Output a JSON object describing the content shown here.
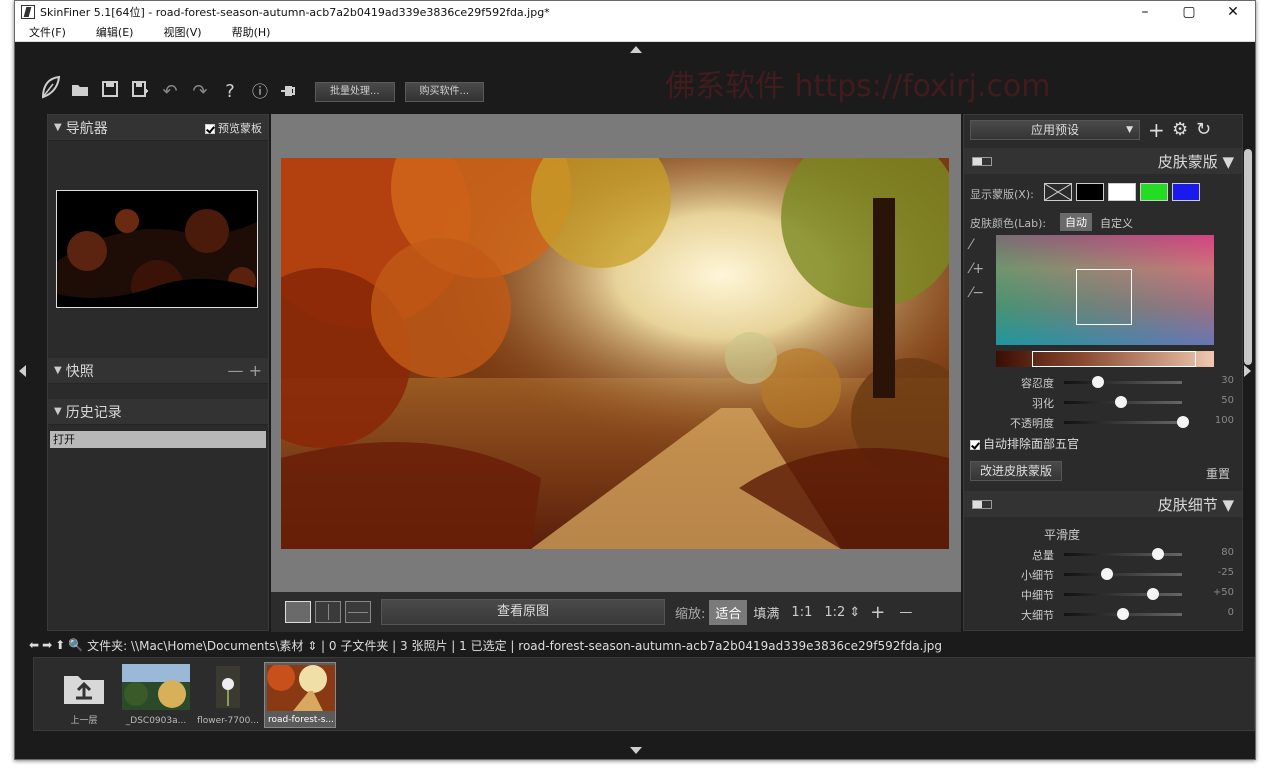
{
  "window": {
    "title": "SkinFiner 5.1[64位] - road-forest-season-autumn-acb7a2b0419ad339e3836ce29f592fda.jpg*",
    "controls": [
      "–",
      "▢",
      "✕"
    ]
  },
  "menu": [
    "文件(F)",
    "编辑(E)",
    "视图(V)",
    "帮助(H)"
  ],
  "toolbar": {
    "icons": [
      "leaf-logo-icon",
      "open-folder-icon",
      "save-icon",
      "save-as-icon",
      "undo-icon",
      "redo-icon",
      "help-icon",
      "info-icon",
      "plugin-icon"
    ],
    "batch_label": "批量处理...",
    "buy_label": "购买软件..."
  },
  "watermark": "佛系软件 https://foxirj.com",
  "left": {
    "navigator_title": "导航器",
    "preview_mask_label": "预览蒙板",
    "snapshot_title": "快照",
    "snapshot_controls": "— +",
    "history_title": "历史记录",
    "history_items": [
      "打开"
    ]
  },
  "center": {
    "view_original_label": "查看原图",
    "zoom_label": "缩放:",
    "zoom_fit": "适合",
    "zoom_fill": "填满",
    "zoom_1_1": "1:1",
    "zoom_1_2": "1:2 ⇕",
    "zoom_in": "+",
    "zoom_out": "—"
  },
  "right": {
    "preset_label": "应用预设",
    "skin_mask_title": "皮肤蒙版 ▼",
    "show_mask_label": "显示蒙版(X):",
    "skin_color_label": "皮肤颜色(Lab):",
    "skin_color_auto": "自动",
    "skin_color_custom": "自定义",
    "mask_sliders": [
      {
        "label": "容忍度",
        "value": "30",
        "fraction": 0.28
      },
      {
        "label": "羽化",
        "value": "50",
        "fraction": 0.5
      },
      {
        "label": "不透明度",
        "value": "100",
        "fraction": 1.0
      }
    ],
    "auto_exclude_label": "自动排除面部五官",
    "improve_mask_label": "改进皮肤蒙版",
    "reset_label": "重置",
    "detail_title": "皮肤细节 ▼",
    "smoothness_title": "平滑度",
    "detail_sliders": [
      {
        "label": "总量",
        "value": "80",
        "fraction": 0.8
      },
      {
        "label": "小细节",
        "value": "-25",
        "fraction": 0.38
      },
      {
        "label": "中细节",
        "value": "+50",
        "fraction": 0.75
      },
      {
        "label": "大细节",
        "value": "0",
        "fraction": 0.5
      }
    ],
    "swatch_colors": [
      "#000000",
      "#ffffff",
      "#22dd22",
      "#1a1aee"
    ]
  },
  "pathbar": {
    "text": "文件夹: \\\\Mac\\Home\\Documents\\素材 ⇕ | 0 子文件夹 | 3 张照片 | 1 已选定 | road-forest-season-autumn-acb7a2b0419ad339e3836ce29f592fda.jpg"
  },
  "filmstrip": [
    {
      "caption": "上一层",
      "kind": "up"
    },
    {
      "caption": "_DSC0903a...",
      "kind": "photo"
    },
    {
      "caption": "flower-7700...",
      "kind": "photo"
    },
    {
      "caption": "road-forest-s...",
      "kind": "photo",
      "selected": true
    }
  ]
}
